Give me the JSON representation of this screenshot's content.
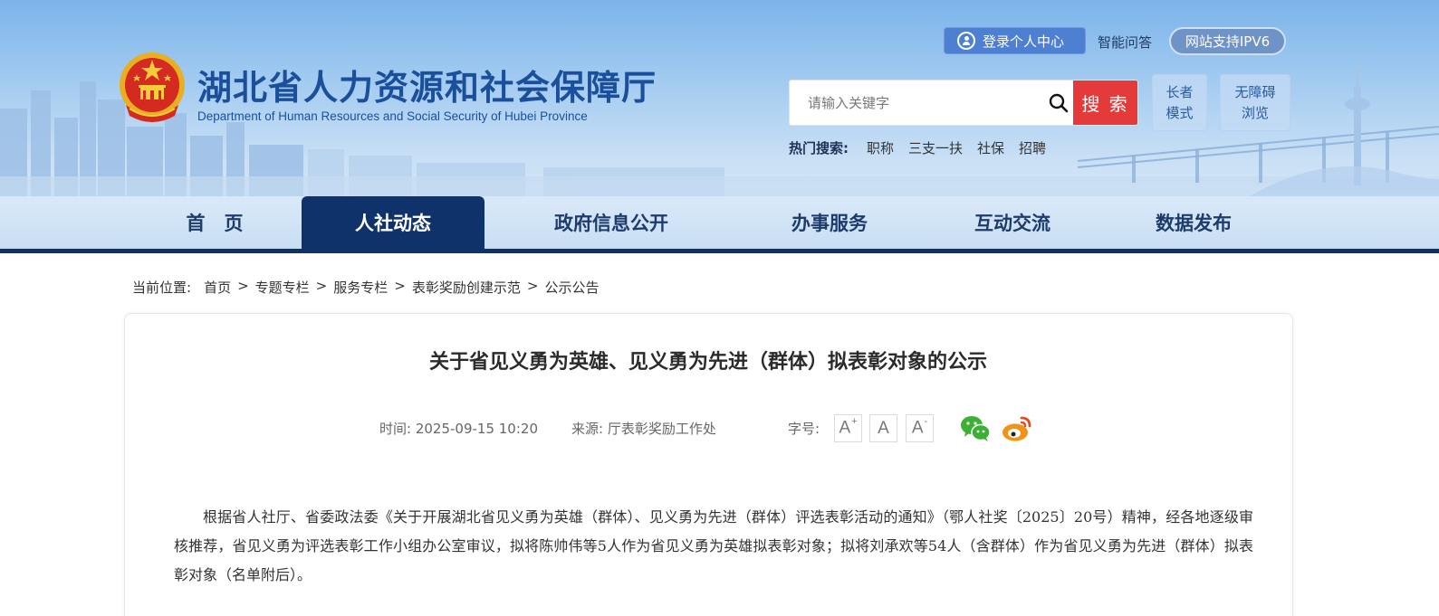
{
  "header": {
    "title_cn": "湖北省人力资源和社会保障厅",
    "title_en": "Department of Human Resources and Social Security of Hubei Province",
    "login_label": "登录个人中心",
    "smart_qa": "智能问答",
    "ipv6_label": "网站支持IPV6",
    "search": {
      "placeholder": "请输入关键字",
      "button_label": "搜 索"
    },
    "hot_search": {
      "label": "热门搜索:",
      "items": [
        "职称",
        "三支一扶",
        "社保",
        "招聘"
      ]
    },
    "elder_mode": [
      "长者",
      "模式"
    ],
    "accessible_mode": [
      "无障碍",
      "浏览"
    ]
  },
  "nav": {
    "items": [
      {
        "label": "首　页",
        "active": false
      },
      {
        "label": "人社动态",
        "active": true
      },
      {
        "label": "政府信息公开",
        "active": false
      },
      {
        "label": "办事服务",
        "active": false
      },
      {
        "label": "互动交流",
        "active": false
      },
      {
        "label": "数据发布",
        "active": false
      }
    ]
  },
  "breadcrumb": {
    "label": "当前位置:",
    "items": [
      "首页",
      "专题专栏",
      "服务专栏",
      "表彰奖励创建示范",
      "公示公告"
    ],
    "separator": ">"
  },
  "article": {
    "title": "关于省见义勇为英雄、见义勇为先进（群体）拟表彰对象的公示",
    "time": "时间:  2025-09-15 10:20",
    "source": "来源:  厅表彰奖励工作处",
    "font_size_label": "字号:",
    "font_buttons": [
      "A+",
      "A",
      "A-"
    ],
    "share_icons": [
      "wechat-icon",
      "weibo-icon"
    ],
    "body": "根据省人社厅、省委政法委《关于开展湖北省见义勇为英雄（群体）、见义勇为先进（群体）评选表彰活动的通知》（鄂人社奖〔2025〕20号）精神，经各地逐级审核推荐，省见义勇为评选表彰工作小组办公室审议，拟将陈帅伟等5人作为省见义勇为英雄拟表彰对象；拟将刘承欢等54人（含群体）作为省见义勇为先进（群体）拟表彰对象（名单附后）。"
  },
  "colors": {
    "nav_active": "#10326a",
    "title_blue": "#1b4f9c",
    "search_button": "#e53a3a",
    "login_button": "#4d7fd2"
  }
}
